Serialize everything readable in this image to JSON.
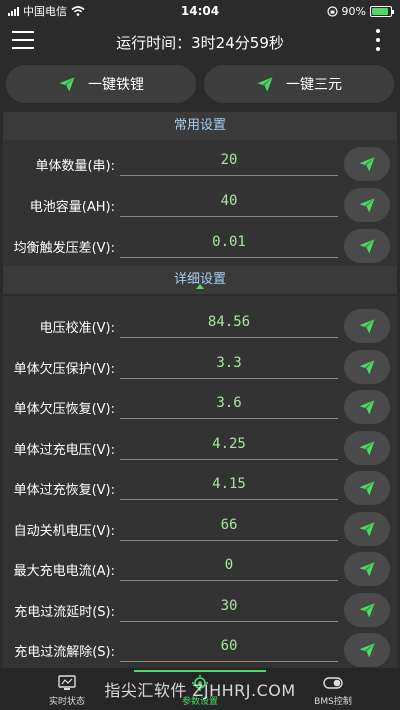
{
  "status_bar": {
    "carrier": "中国电信",
    "time": "14:04",
    "battery": "90%",
    "battery_level": 0.9
  },
  "header": {
    "title": "运行时间：3时24分59秒"
  },
  "quick_actions": [
    {
      "label": "一键铁锂"
    },
    {
      "label": "一键三元"
    }
  ],
  "common_settings": {
    "title": "常用设置",
    "rows": [
      {
        "label": "单体数量(串):",
        "value": "20"
      },
      {
        "label": "电池容量(AH):",
        "value": "40"
      },
      {
        "label": "均衡触发压差(V):",
        "value": "0.01"
      }
    ]
  },
  "detail_settings": {
    "title": "详细设置",
    "rows": [
      {
        "label": "电压校准(V):",
        "value": "84.56"
      },
      {
        "label": "单体欠压保护(V):",
        "value": "3.3"
      },
      {
        "label": "单体欠压恢复(V):",
        "value": "3.6"
      },
      {
        "label": "单体过充电压(V):",
        "value": "4.25"
      },
      {
        "label": "单体过充恢复(V):",
        "value": "4.15"
      },
      {
        "label": "自动关机电压(V):",
        "value": "66"
      },
      {
        "label": "最大充电电流(A):",
        "value": "0"
      },
      {
        "label": "充电过流延时(S):",
        "value": "30"
      },
      {
        "label": "充电过流解除(S):",
        "value": "60"
      }
    ]
  },
  "tabs": [
    {
      "label": "实时状态",
      "icon": "monitor-icon",
      "active": false
    },
    {
      "label": "参数设置",
      "icon": "settings-icon",
      "active": true
    },
    {
      "label": "BMS控制",
      "icon": "toggle-icon",
      "active": false
    }
  ],
  "watermark": "指尖汇软件 ZJHHRJ.COM",
  "colors": {
    "background": "#2b2b2b",
    "accent_green": "#4cd964",
    "section_title": "#a8cdf5",
    "value_text": "#a8e6a0"
  }
}
